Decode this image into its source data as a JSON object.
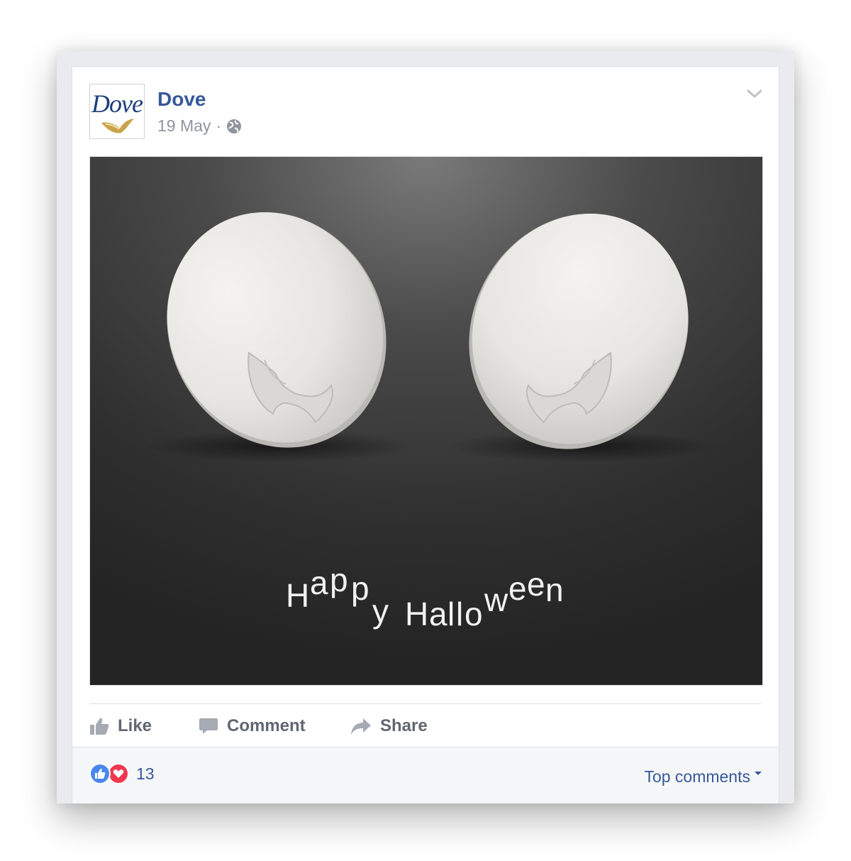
{
  "post": {
    "page_name": "Dove",
    "date": "19 May",
    "separator": "·",
    "avatar_logo_text": "Dove",
    "image_text": "Happy Halloween"
  },
  "actions": {
    "like_label": "Like",
    "comment_label": "Comment",
    "share_label": "Share"
  },
  "footer": {
    "reaction_count": "13",
    "top_comments_label": "Top comments"
  },
  "icons": {
    "privacy": "globe-icon",
    "options": "chevron-down-icon",
    "like": "thumbs-up-icon",
    "comment": "speech-bubble-icon",
    "share": "share-arrow-icon",
    "reaction_like": "like-reaction-icon",
    "reaction_love": "love-reaction-icon"
  },
  "colors": {
    "link": "#365899",
    "muted": "#90949c",
    "action": "#606770",
    "frame": "#e9ebee",
    "footer_bg": "#f5f6f7",
    "like_blue": "#4a86f0",
    "love_red": "#f0384e"
  }
}
